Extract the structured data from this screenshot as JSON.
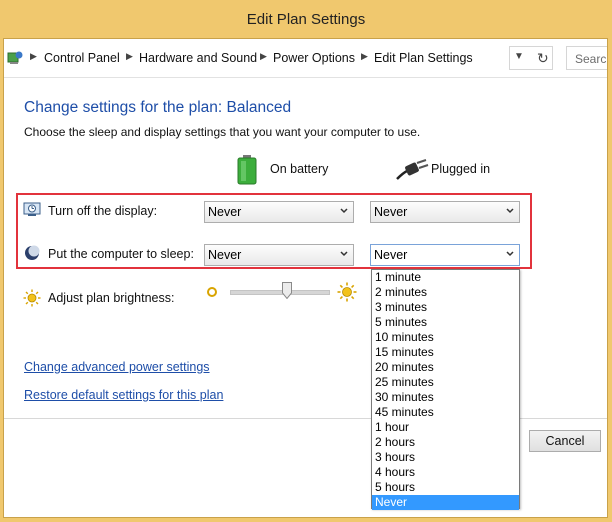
{
  "window": {
    "title": "Edit Plan Settings"
  },
  "address_bar": {
    "breadcrumbs": [
      "Control Panel",
      "Hardware and Sound",
      "Power Options",
      "Edit Plan Settings"
    ],
    "search_placeholder": "Search"
  },
  "main": {
    "heading": "Change settings for the plan: Balanced",
    "description": "Choose the sleep and display settings that you want your computer to use.",
    "columns": {
      "battery": "On battery",
      "plugged": "Plugged in"
    },
    "rows": [
      {
        "label": "Turn off the display:",
        "battery_value": "Never",
        "plugged_value": "Never"
      },
      {
        "label": "Put the computer to sleep:",
        "battery_value": "Never",
        "plugged_value": "Never"
      }
    ],
    "brightness_label": "Adjust plan brightness:",
    "links": {
      "advanced": "Change advanced power settings",
      "restore": "Restore default settings for this plan"
    }
  },
  "footer": {
    "cancel": "Cancel"
  },
  "dropdown": {
    "options": [
      "1 minute",
      "2 minutes",
      "3 minutes",
      "5 minutes",
      "10 minutes",
      "15 minutes",
      "20 minutes",
      "25 minutes",
      "30 minutes",
      "45 minutes",
      "1 hour",
      "2 hours",
      "3 hours",
      "4 hours",
      "5 hours",
      "Never"
    ],
    "selected": "Never"
  },
  "colors": {
    "accent_link": "#1e4ea8",
    "highlight_box": "#e2333c",
    "selection": "#3399ff",
    "title_bar": "#f0c86e"
  }
}
